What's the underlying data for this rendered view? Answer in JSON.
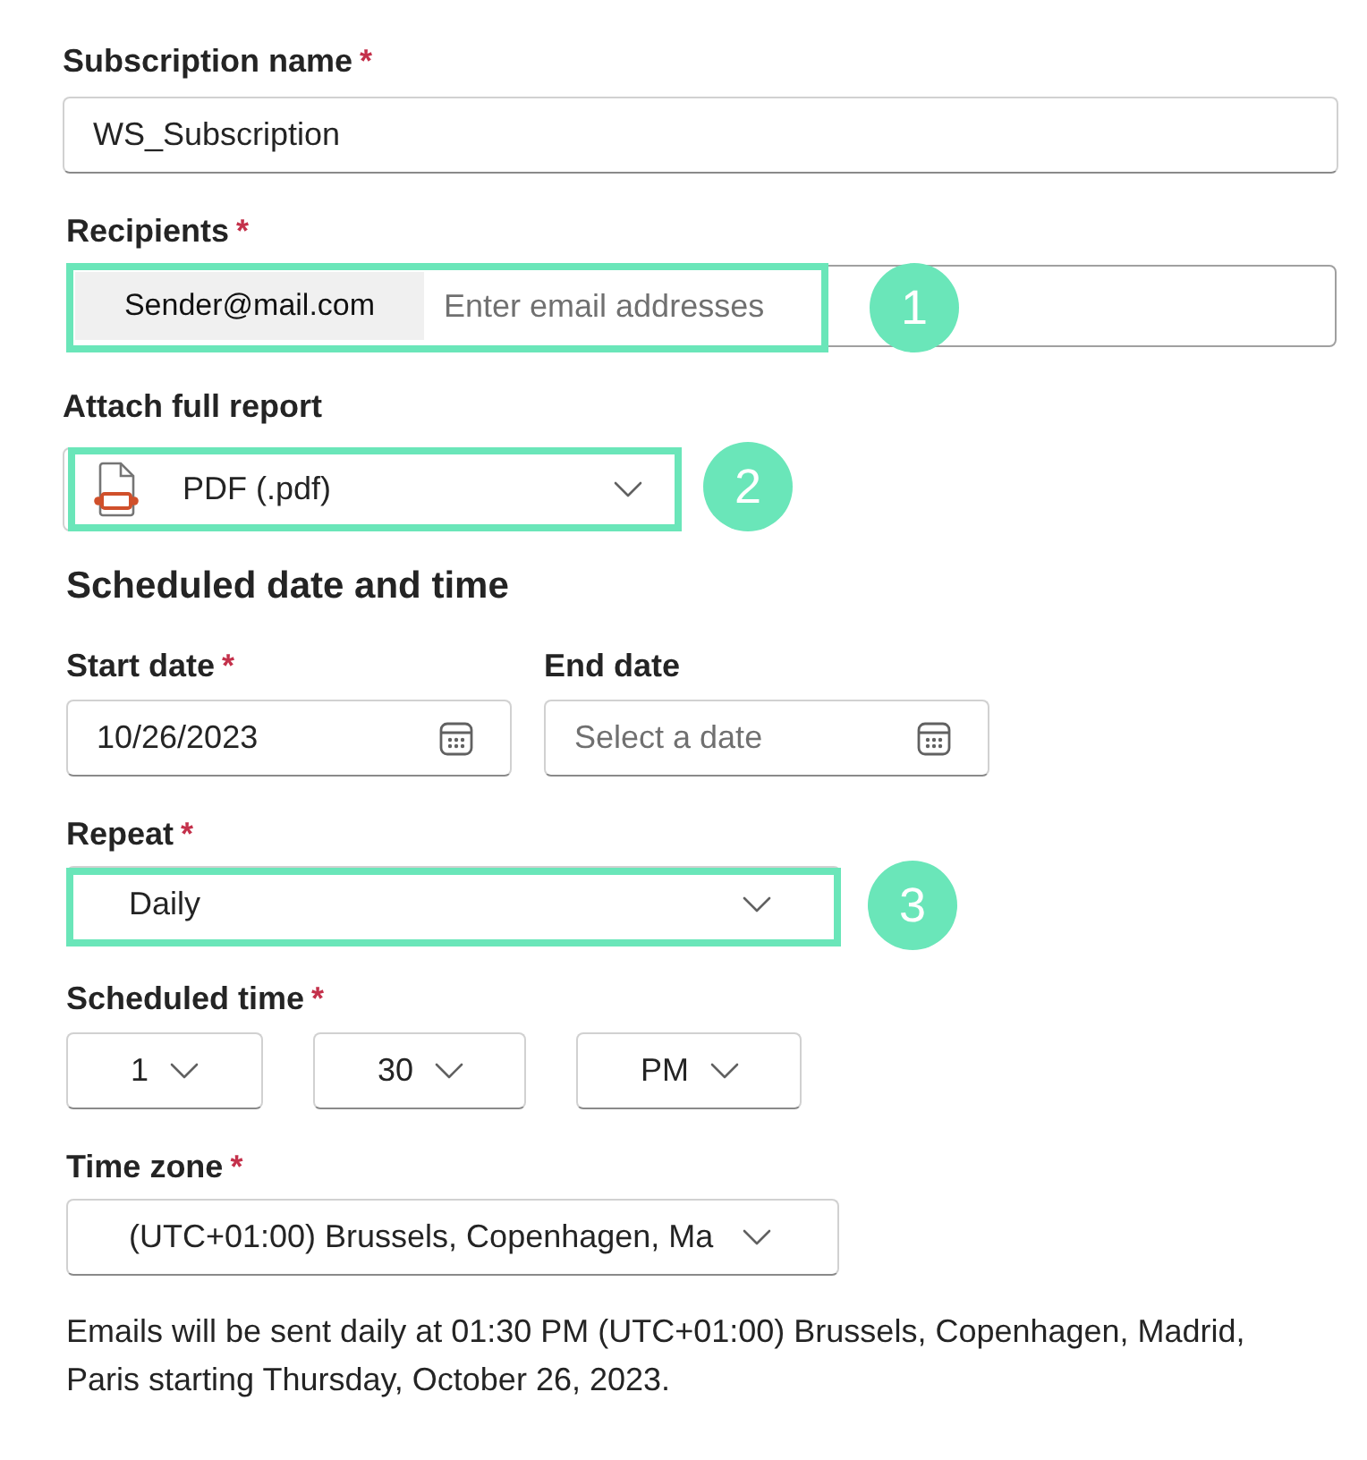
{
  "subscription_name": {
    "label": "Subscription name",
    "required_mark": "*",
    "value": "WS_Subscription"
  },
  "recipients": {
    "label": "Recipients",
    "required_mark": "*",
    "chips": [
      "Sender@mail.com"
    ],
    "placeholder": "Enter email addresses",
    "callout": "1"
  },
  "attach_full_report": {
    "label": "Attach full report",
    "value": "PDF (.pdf)",
    "callout": "2"
  },
  "schedule": {
    "heading": "Scheduled date and time",
    "start_date": {
      "label": "Start date",
      "required_mark": "*",
      "value": "10/26/2023"
    },
    "end_date": {
      "label": "End date",
      "placeholder": "Select a date"
    },
    "repeat": {
      "label": "Repeat",
      "required_mark": "*",
      "value": "Daily",
      "callout": "3"
    },
    "scheduled_time": {
      "label": "Scheduled time",
      "required_mark": "*",
      "hour": "1",
      "minute": "30",
      "period": "PM"
    },
    "time_zone": {
      "label": "Time zone",
      "required_mark": "*",
      "value": "(UTC+01:00) Brussels, Copenhagen, Ma"
    }
  },
  "summary": "Emails will be sent daily at 01:30 PM (UTC+01:00) Brussels, Copenhagen, Madrid, Paris starting Thursday, October 26, 2023."
}
